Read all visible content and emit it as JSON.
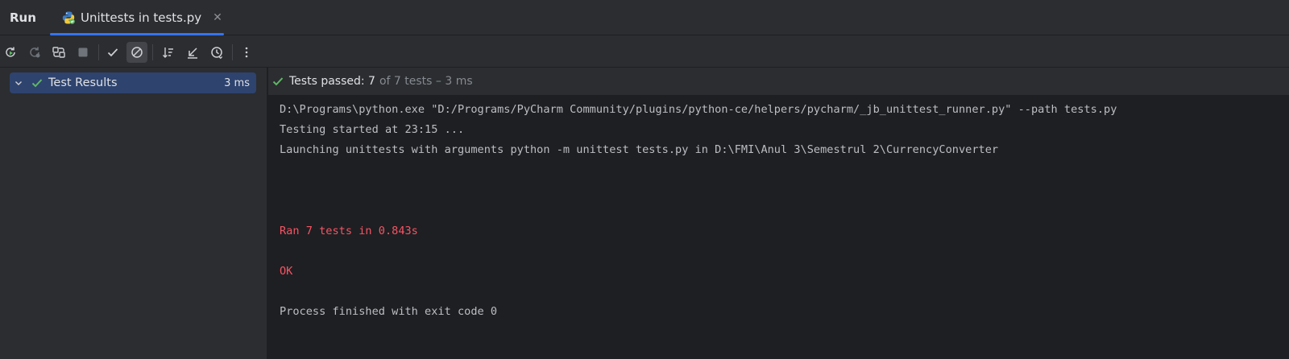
{
  "tabbar": {
    "run_label": "Run",
    "active_tab_label": "Unittests in tests.py",
    "close_glyph": "✕"
  },
  "toolbar": {
    "buttons": [
      {
        "name": "rerun-icon",
        "tooltip": "Rerun"
      },
      {
        "name": "rerun-failed-icon",
        "tooltip": "Rerun Failed Tests"
      },
      {
        "name": "toggle-auto-test-icon",
        "tooltip": "Toggle auto-test"
      },
      {
        "name": "stop-icon",
        "tooltip": "Stop"
      },
      {
        "name": "show-passed-icon",
        "tooltip": "Show Passed"
      },
      {
        "name": "show-ignored-icon",
        "tooltip": "Show Ignored"
      },
      {
        "name": "sort-alphabetically-icon",
        "tooltip": "Sort Alphabetically"
      },
      {
        "name": "collapse-all-icon",
        "tooltip": "Collapse All"
      },
      {
        "name": "test-history-icon",
        "tooltip": "Test History"
      },
      {
        "name": "more-options-icon",
        "tooltip": "More"
      }
    ]
  },
  "tree": {
    "root_label": "Test Results",
    "root_time": "3 ms"
  },
  "status": {
    "passed_prefix": "Tests passed: 7",
    "passed_suffix": "of 7 tests – 3 ms"
  },
  "console": {
    "lines": [
      {
        "text": "D:\\Programs\\python.exe \"D:/Programs/PyCharm Community/plugins/python-ce/helpers/pycharm/_jb_unittest_runner.py\" --path tests.py",
        "kind": "normal"
      },
      {
        "text": "Testing started at 23:15 ...",
        "kind": "normal"
      },
      {
        "text": "Launching unittests with arguments python -m unittest tests.py in D:\\FMI\\Anul 3\\Semestrul 2\\CurrencyConverter",
        "kind": "normal"
      },
      {
        "text": "Ran 7 tests in 0.843s",
        "kind": "err"
      },
      {
        "text": "OK",
        "kind": "err"
      },
      {
        "text": "Process finished with exit code 0",
        "kind": "normal"
      }
    ]
  },
  "colors": {
    "accent": "#3574f0",
    "success": "#5fb865",
    "error_text": "#f75464",
    "panel_bg": "#2b2d30",
    "console_bg": "#1e1f22"
  }
}
